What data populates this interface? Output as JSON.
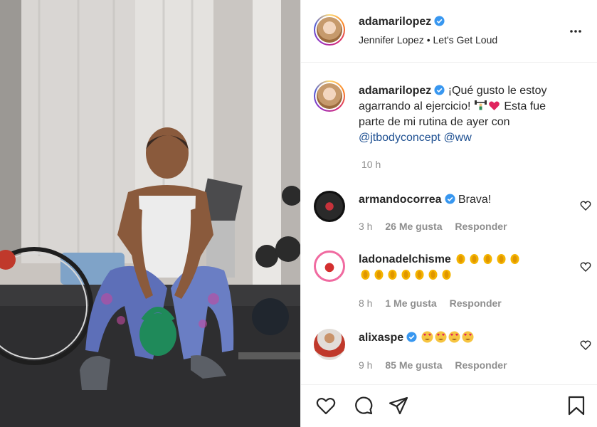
{
  "post": {
    "username": "adamarilopez",
    "audio": "Jennifer Lopez • Let's Get Loud",
    "caption": {
      "username": "adamarilopez",
      "text_line1": "¡Qué gusto le estoy",
      "text_line2": "agarrando al ejercicio!",
      "text_line3": "Esta fue",
      "text_line4": "parte de mi rutina de ayer con",
      "mention1": "@jtbodyconcept",
      "mention2": "@ww"
    },
    "time": "10 h"
  },
  "comments": [
    {
      "username": "armandocorrea",
      "text": "Brava!",
      "time": "3 h",
      "likes": "26 Me gusta",
      "reply": "Responder"
    },
    {
      "username": "ladonadelchisme",
      "text": "",
      "time": "8 h",
      "likes": "1 Me gusta",
      "reply": "Responder"
    },
    {
      "username": "alixaspe",
      "text": "",
      "time": "9 h",
      "likes": "85 Me gusta",
      "reply": "Responder"
    }
  ],
  "icons": {
    "verified": "verified-badge-icon",
    "more": "more-options-icon",
    "like": "heart-icon",
    "comment": "comment-bubble-icon",
    "share": "paper-plane-icon",
    "save": "bookmark-icon",
    "comment_like": "small-heart-icon"
  },
  "colors": {
    "link": "#1d4f91",
    "verified": "#3897f0",
    "muted": "#8e8e8e",
    "text": "#262626"
  }
}
